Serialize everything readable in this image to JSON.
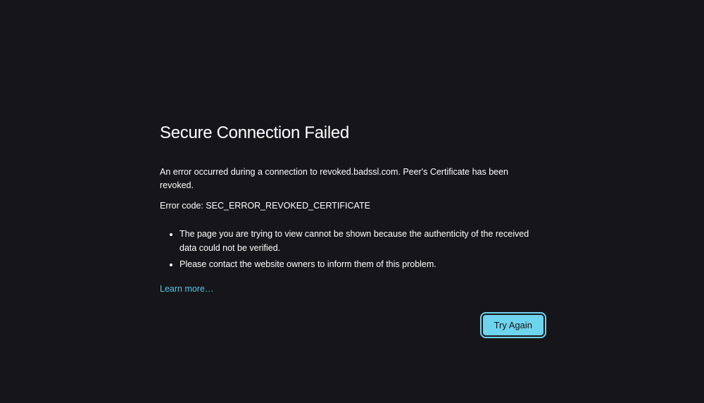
{
  "error": {
    "title": "Secure Connection Failed",
    "message": "An error occurred during a connection to revoked.badssl.com. Peer's Certificate has been revoked.",
    "code_line": "Error code: SEC_ERROR_REVOKED_CERTIFICATE",
    "bullets": [
      "The page you are trying to view cannot be shown because the authenticity of the received data could not be verified.",
      "Please contact the website owners to inform them of this problem."
    ],
    "learn_more": "Learn more…",
    "try_again": "Try Again"
  }
}
